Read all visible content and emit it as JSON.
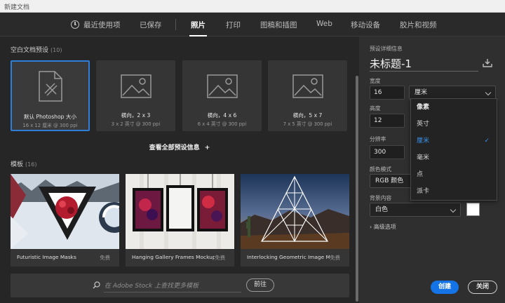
{
  "window": {
    "title": "新建文档"
  },
  "tabs": [
    {
      "label": "最近使用项"
    },
    {
      "label": "已保存"
    },
    {
      "label": "照片"
    },
    {
      "label": "打印"
    },
    {
      "label": "图稿和插图"
    },
    {
      "label": "Web"
    },
    {
      "label": "移动设备"
    },
    {
      "label": "胶片和视频"
    }
  ],
  "active_tab": "照片",
  "presets_section": {
    "title": "空白文档预设",
    "count": "(10)"
  },
  "presets": [
    {
      "name": "默认 Photoshop 大小",
      "size": "16 x 12 厘米 @ 300 ppi",
      "icon": "document-brush-icon",
      "selected": true
    },
    {
      "name": "横向，2 x 3",
      "size": "3 x 2 英寸 @ 300 ppi",
      "icon": "image-icon"
    },
    {
      "name": "横向，4 x 6",
      "size": "6 x 4 英寸 @ 300 ppi",
      "icon": "image-icon"
    },
    {
      "name": "横向，5 x 7",
      "size": "7 x 5 英寸 @ 300 ppi",
      "icon": "image-icon"
    }
  ],
  "view_all": "查看全部预设信息",
  "templates_section": {
    "title": "模板",
    "count": "(16)"
  },
  "templates": [
    {
      "name": "Futuristic Image Masks",
      "price": "免费"
    },
    {
      "name": "Hanging Gallery Frames Mockups",
      "price": "免费"
    },
    {
      "name": "Interlocking Geometric Image M...",
      "price": "免费"
    }
  ],
  "search": {
    "placeholder": "在 Adobe Stock 上查找更多模板",
    "button": "前往"
  },
  "details": {
    "title": "预设详细信息",
    "doc_name": "未标题-1",
    "width_label": "宽度",
    "width_value": "16",
    "unit_value": "厘米",
    "height_label": "高度",
    "height_value": "12",
    "resolution_label": "分辨率",
    "resolution_value": "300",
    "color_mode_label": "颜色模式",
    "color_mode_value": "RGB 颜色",
    "background_label": "背景内容",
    "background_value": "白色",
    "background_swatch": "#ffffff",
    "advanced": "高级选项"
  },
  "unit_menu": {
    "items": [
      "像素",
      "英寸",
      "厘米",
      "毫米",
      "点",
      "派卡"
    ],
    "selected": "厘米"
  },
  "buttons": {
    "create": "创建",
    "close": "关闭"
  },
  "colors": {
    "accent": "#1473e6",
    "selection_border": "#2f7fd8",
    "menu_selected": "#3b92ea"
  }
}
